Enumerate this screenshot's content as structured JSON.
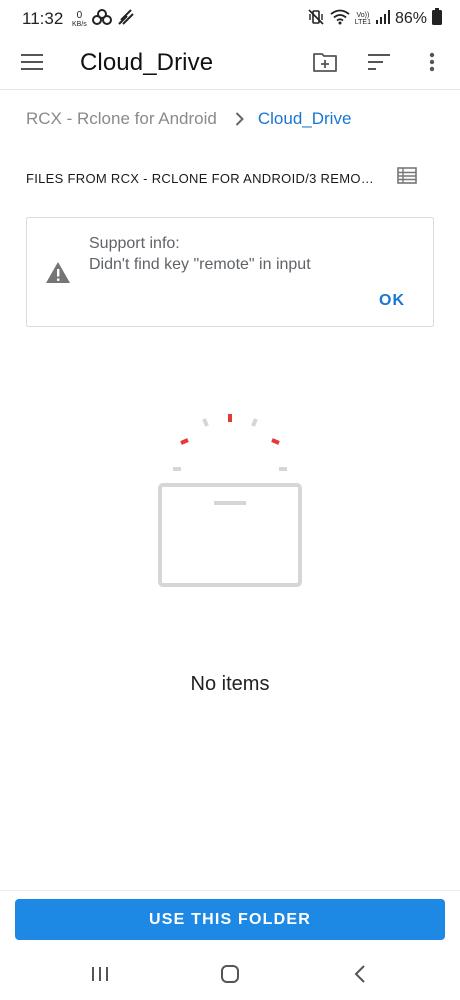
{
  "status_bar": {
    "time": "11:32",
    "data_speed_value": "0",
    "data_speed_unit": "KB/s",
    "network_label_top": "Vo))",
    "network_label_bottom": "LTE1",
    "battery": "86%"
  },
  "app_bar": {
    "title": "Cloud_Drive",
    "icons": [
      "menu-icon",
      "new-folder-icon",
      "sort-icon",
      "more-vert-icon"
    ]
  },
  "breadcrumb": {
    "root": "RCX - Rclone for Android",
    "current": "Cloud_Drive"
  },
  "section": {
    "title": "FILES FROM RCX - RCLONE FOR ANDROID/3 REMOTE..."
  },
  "support_card": {
    "title": "Support info:",
    "message": "Didn't find key \"remote\" in input",
    "ok_label": "OK"
  },
  "empty_state": {
    "text": "No items"
  },
  "bottom": {
    "button_label": "USE THIS FOLDER"
  },
  "colors": {
    "accent": "#1976d2",
    "button": "#1e88e5",
    "illustration_red": "#e53935",
    "illustration_gray": "#d6d6d6"
  }
}
